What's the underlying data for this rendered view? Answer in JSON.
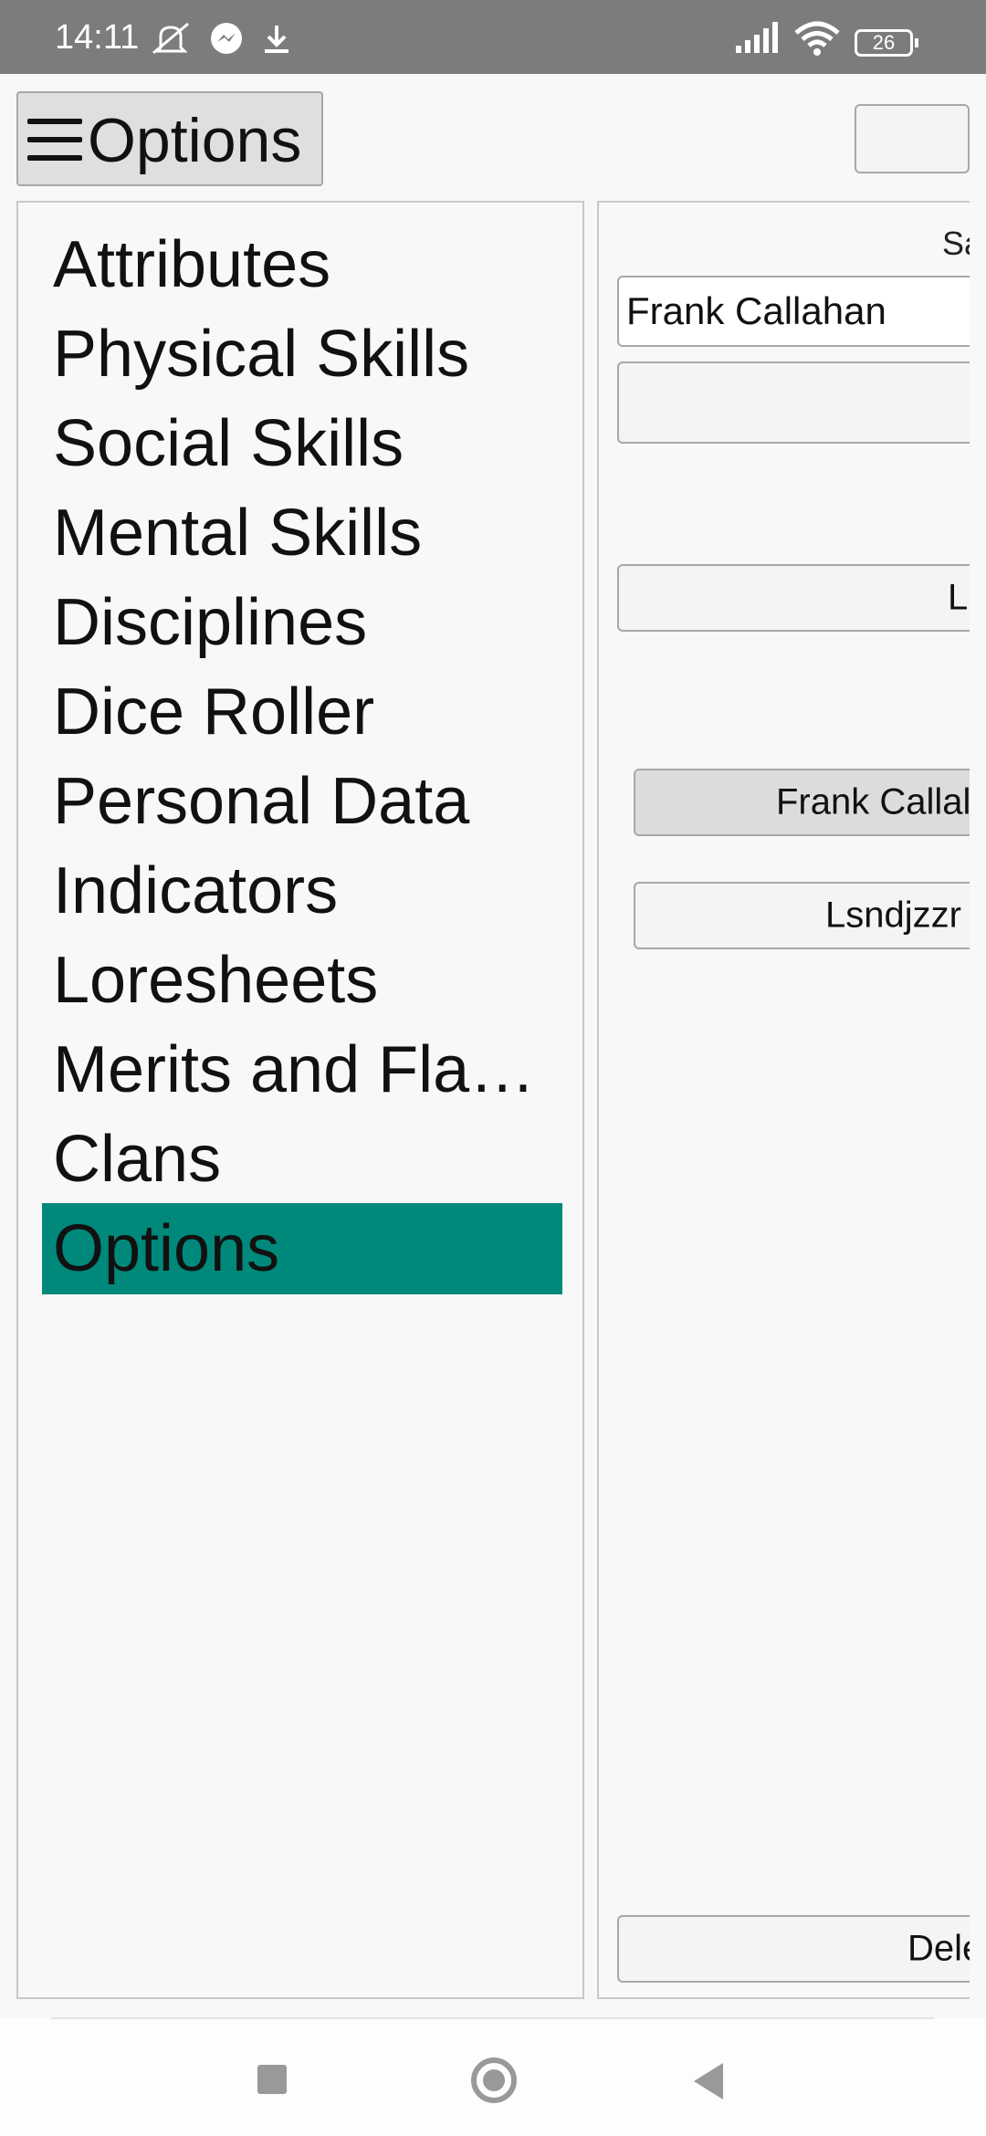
{
  "status_bar": {
    "time": "14:11",
    "icons": [
      "muted-bell-icon",
      "messenger-icon",
      "download-icon",
      "signal-icon",
      "wifi-icon",
      "battery-icon"
    ],
    "battery_level": "26"
  },
  "header": {
    "menu_button_label": "Options",
    "menu_icon": "hamburger-icon"
  },
  "left_nav": {
    "items": [
      {
        "label": "Attributes"
      },
      {
        "label": "Physical Skills"
      },
      {
        "label": "Social Skills"
      },
      {
        "label": "Mental Skills"
      },
      {
        "label": "Disciplines"
      },
      {
        "label": "Dice Roller"
      },
      {
        "label": "Personal Data"
      },
      {
        "label": "Indicators"
      },
      {
        "label": "Loresheets"
      },
      {
        "label": "Merits and Fla…"
      },
      {
        "label": "Clans"
      },
      {
        "label": "Options"
      }
    ],
    "selected_label": "Options",
    "selected_color": "#00897b"
  },
  "right_panel": {
    "top_label": "Sa",
    "name_input_value": "Frank Callahan",
    "button_2_label": "L",
    "character_buttons": [
      {
        "label": "Frank Callal"
      },
      {
        "label": "Lsndjzzr"
      }
    ],
    "bottom_button_label": "Dele"
  },
  "nav_bar": {
    "icons": [
      "recents-square-icon",
      "home-circle-icon",
      "back-triangle-icon"
    ]
  }
}
